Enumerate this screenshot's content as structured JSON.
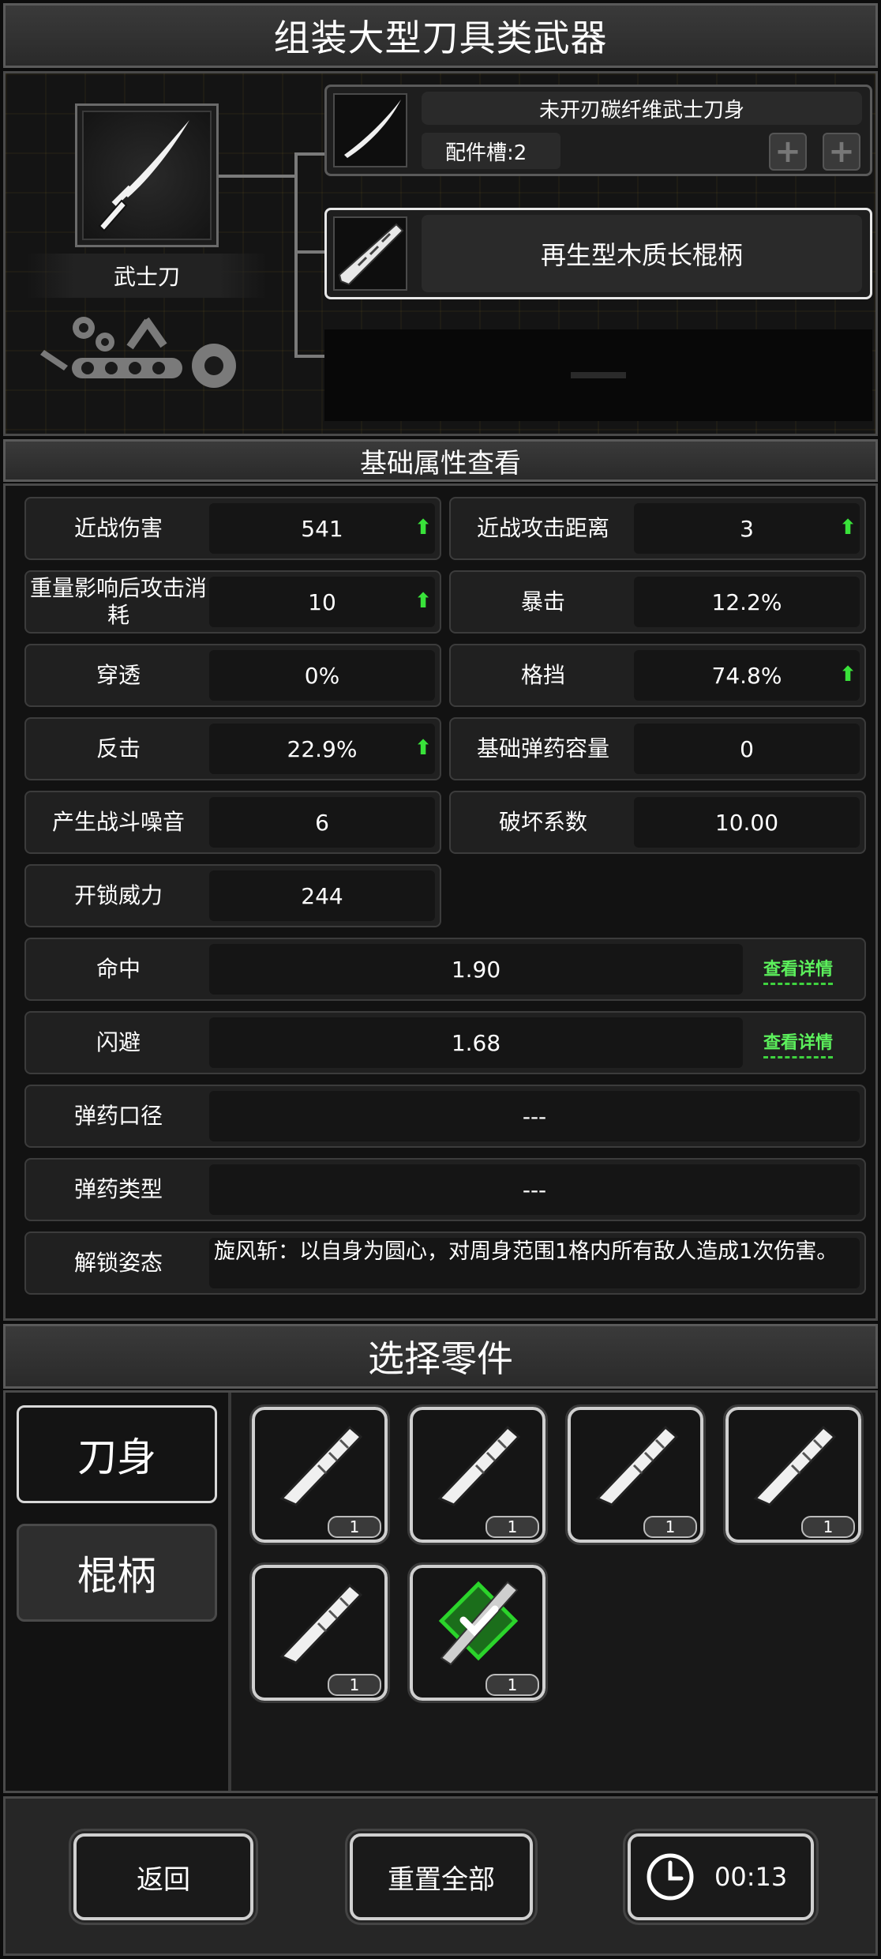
{
  "title": "组装大型刀具类武器",
  "weapon": {
    "name": "武士刀",
    "icon": "katana-icon"
  },
  "parts": {
    "blade": {
      "name": "未开刃碳纤维武士刀身",
      "slots_label": "配件槽:2",
      "plus_symbol": "+"
    },
    "handle": {
      "name": "再生型木质长棍柄"
    }
  },
  "stats_section_title": "基础属性查看",
  "stats": [
    {
      "label": "近战伤害",
      "value": "541",
      "up": true
    },
    {
      "label": "近战攻击距离",
      "value": "3",
      "up": true
    },
    {
      "label": "重量影响后攻击消耗",
      "value": "10",
      "up": true
    },
    {
      "label": "暴击",
      "value": "12.2%",
      "up": false
    },
    {
      "label": "穿透",
      "value": "0%",
      "up": false
    },
    {
      "label": "格挡",
      "value": "74.8%",
      "up": true
    },
    {
      "label": "反击",
      "value": "22.9%",
      "up": true
    },
    {
      "label": "基础弹药容量",
      "value": "0",
      "up": false
    },
    {
      "label": "产生战斗噪音",
      "value": "6",
      "up": false
    },
    {
      "label": "破坏系数",
      "value": "10.00",
      "up": false
    },
    {
      "label": "开锁威力",
      "value": "244",
      "up": false
    }
  ],
  "up_arrow": "⬆",
  "wide_stats": [
    {
      "label": "命中",
      "value": "1.90",
      "link": "查看详情"
    },
    {
      "label": "闪避",
      "value": "1.68",
      "link": "查看详情"
    },
    {
      "label": "弹药口径",
      "value": "---"
    },
    {
      "label": "弹药类型",
      "value": "---"
    },
    {
      "label": "解锁姿态",
      "value": "旋风斩：以自身为圆心，对周身范围1格内所有敌人造成1次伤害。"
    }
  ],
  "select_section_title": "选择零件",
  "tabs": [
    {
      "label": "刀身",
      "active": true
    },
    {
      "label": "棍柄",
      "active": false
    }
  ],
  "items": [
    {
      "icon": "handle-part-icon",
      "count": "1",
      "selected": false
    },
    {
      "icon": "handle-part-icon",
      "count": "1",
      "selected": false
    },
    {
      "icon": "handle-part-icon",
      "count": "1",
      "selected": false
    },
    {
      "icon": "handle-part-icon",
      "count": "1",
      "selected": false
    },
    {
      "icon": "handle-part-icon",
      "count": "1",
      "selected": false
    },
    {
      "icon": "wooden-staff-handle-icon",
      "count": "1",
      "selected": true
    }
  ],
  "footer": {
    "back_label": "返回",
    "reset_label": "重置全部",
    "timer": "00:13"
  },
  "colors": {
    "accent_green": "#39e23a",
    "selected_green": "#2bd42b"
  }
}
